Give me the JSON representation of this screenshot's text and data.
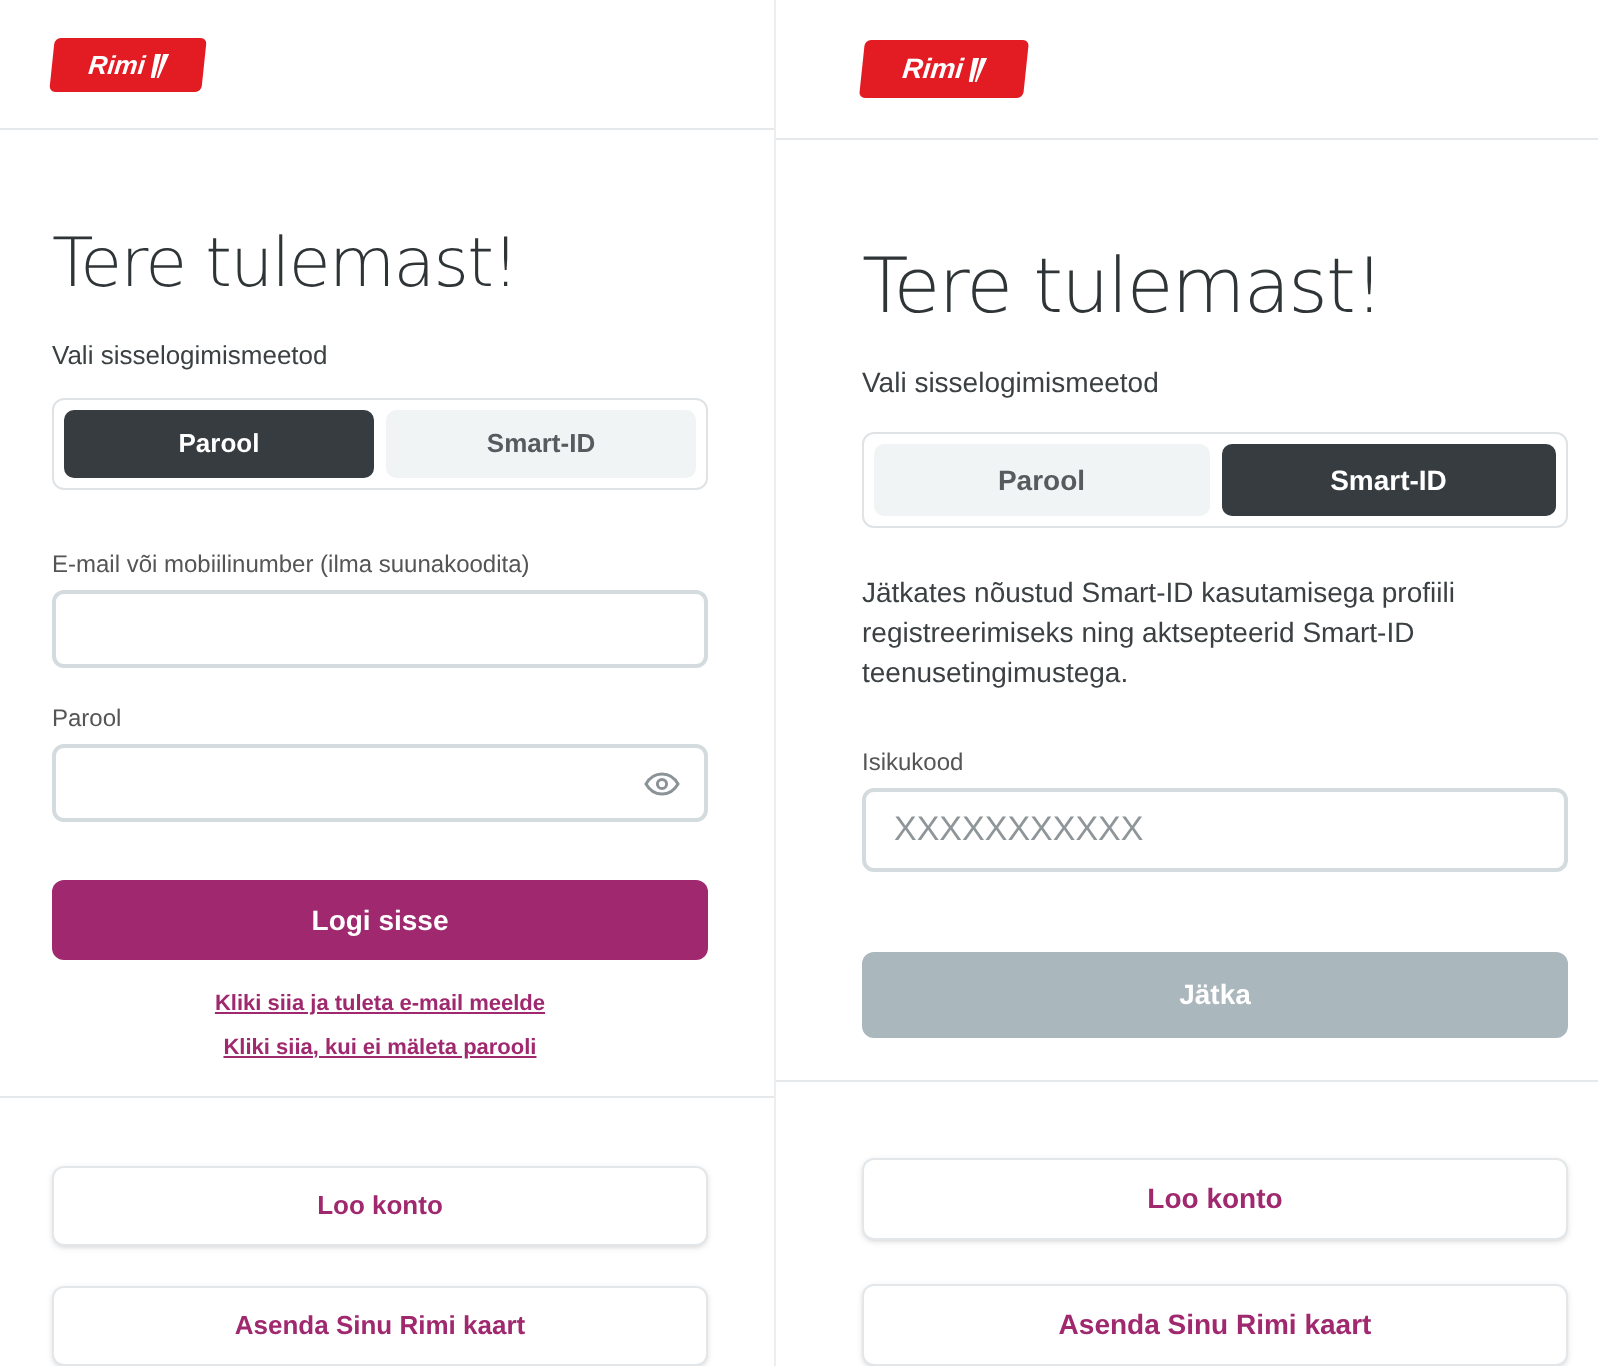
{
  "panels": [
    {
      "logo": {
        "text": "Rimi"
      },
      "title": "Tere tulemast!",
      "method_label": "Vali sisselogimismeetod",
      "tabs": [
        {
          "label": "Parool",
          "selected": true
        },
        {
          "label": "Smart-ID",
          "selected": false
        }
      ],
      "fields": [
        {
          "kind": "text",
          "label": "E-mail või mobiilinumber (ilma suunakoodita)"
        },
        {
          "kind": "password",
          "label": "Parool"
        }
      ],
      "submit": {
        "label": "Logi sisse",
        "disabled": false
      },
      "links": [
        "Kliki siia ja tuleta e-mail meelde",
        "Kliki siia, kui ei mäleta parooli"
      ],
      "secondary_buttons": [
        "Loo konto",
        "Asenda Sinu Rimi kaart"
      ]
    },
    {
      "logo": {
        "text": "Rimi"
      },
      "title": "Tere tulemast!",
      "method_label": "Vali sisselogimismeetod",
      "tabs": [
        {
          "label": "Parool",
          "selected": false
        },
        {
          "label": "Smart-ID",
          "selected": true
        }
      ],
      "info": "Jätkates nõustud Smart-ID kasutamisega profiili registreerimiseks ning aktsepteerid Smart-ID teenusetingimustega.",
      "fields": [
        {
          "kind": "text",
          "label": "Isikukood",
          "placeholder": "XXXXXXXXXXX"
        }
      ],
      "submit": {
        "label": "Jätka",
        "disabled": true
      },
      "secondary_buttons": [
        "Loo konto",
        "Asenda Sinu Rimi kaart"
      ]
    }
  ]
}
